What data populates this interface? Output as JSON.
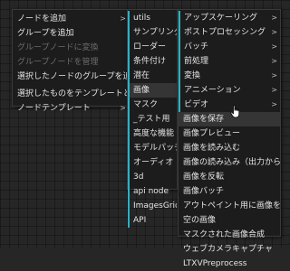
{
  "menu1": {
    "items": [
      {
        "label": "ノードを追加",
        "has_submenu": true,
        "disabled": false
      },
      {
        "label": "グループを追加",
        "has_submenu": false,
        "disabled": false
      },
      {
        "label": "グループノードに変換",
        "has_submenu": false,
        "disabled": true
      },
      {
        "label": "グループノードを管理",
        "has_submenu": false,
        "disabled": true
      },
      {
        "label": "選択したノードのグループを追加",
        "has_submenu": false,
        "disabled": false
      },
      {
        "label": "選択したものをテンプレートとして保存",
        "has_submenu": false,
        "disabled": false
      },
      {
        "label": "ノードテンプレート",
        "has_submenu": true,
        "disabled": false
      }
    ]
  },
  "menu2": {
    "items": [
      {
        "label": "utils"
      },
      {
        "label": "サンプリング"
      },
      {
        "label": "ローダー"
      },
      {
        "label": "条件付け"
      },
      {
        "label": "潜在"
      },
      {
        "label": "画像"
      },
      {
        "label": "マスク"
      },
      {
        "label": "_テスト用"
      },
      {
        "label": "高度な機能"
      },
      {
        "label": "モデルパッチ"
      },
      {
        "label": "オーディオ"
      },
      {
        "label": "3d"
      },
      {
        "label": "api node"
      },
      {
        "label": "ImagesGrid"
      },
      {
        "label": "API"
      }
    ]
  },
  "menu3": {
    "items": [
      {
        "label": "アップスケーリング",
        "has_submenu": true
      },
      {
        "label": "ポストプロセッシング",
        "has_submenu": true
      },
      {
        "label": "バッチ",
        "has_submenu": true
      },
      {
        "label": "前処理",
        "has_submenu": true
      },
      {
        "label": "変換",
        "has_submenu": true
      },
      {
        "label": "アニメーション",
        "has_submenu": true
      },
      {
        "label": "ビデオ",
        "has_submenu": true
      },
      {
        "label": "画像を保存",
        "has_submenu": false
      },
      {
        "label": "画像プレビュー",
        "has_submenu": false
      },
      {
        "label": "画像を読み込む",
        "has_submenu": false
      },
      {
        "label": "画像の読み込み（出力から）",
        "has_submenu": false
      },
      {
        "label": "画像を反転",
        "has_submenu": false
      },
      {
        "label": "画像バッチ",
        "has_submenu": false
      },
      {
        "label": "アウトペイント用に画像をパッド",
        "has_submenu": false
      },
      {
        "label": "空の画像",
        "has_submenu": false
      },
      {
        "label": "マスクされた画像合成",
        "has_submenu": false
      },
      {
        "label": "ウェブカメラキャプチャ",
        "has_submenu": false
      },
      {
        "label": "LTXVPreprocess",
        "has_submenu": false
      }
    ]
  },
  "arrow_glyph": ">",
  "accent_color": "#27b3c7"
}
